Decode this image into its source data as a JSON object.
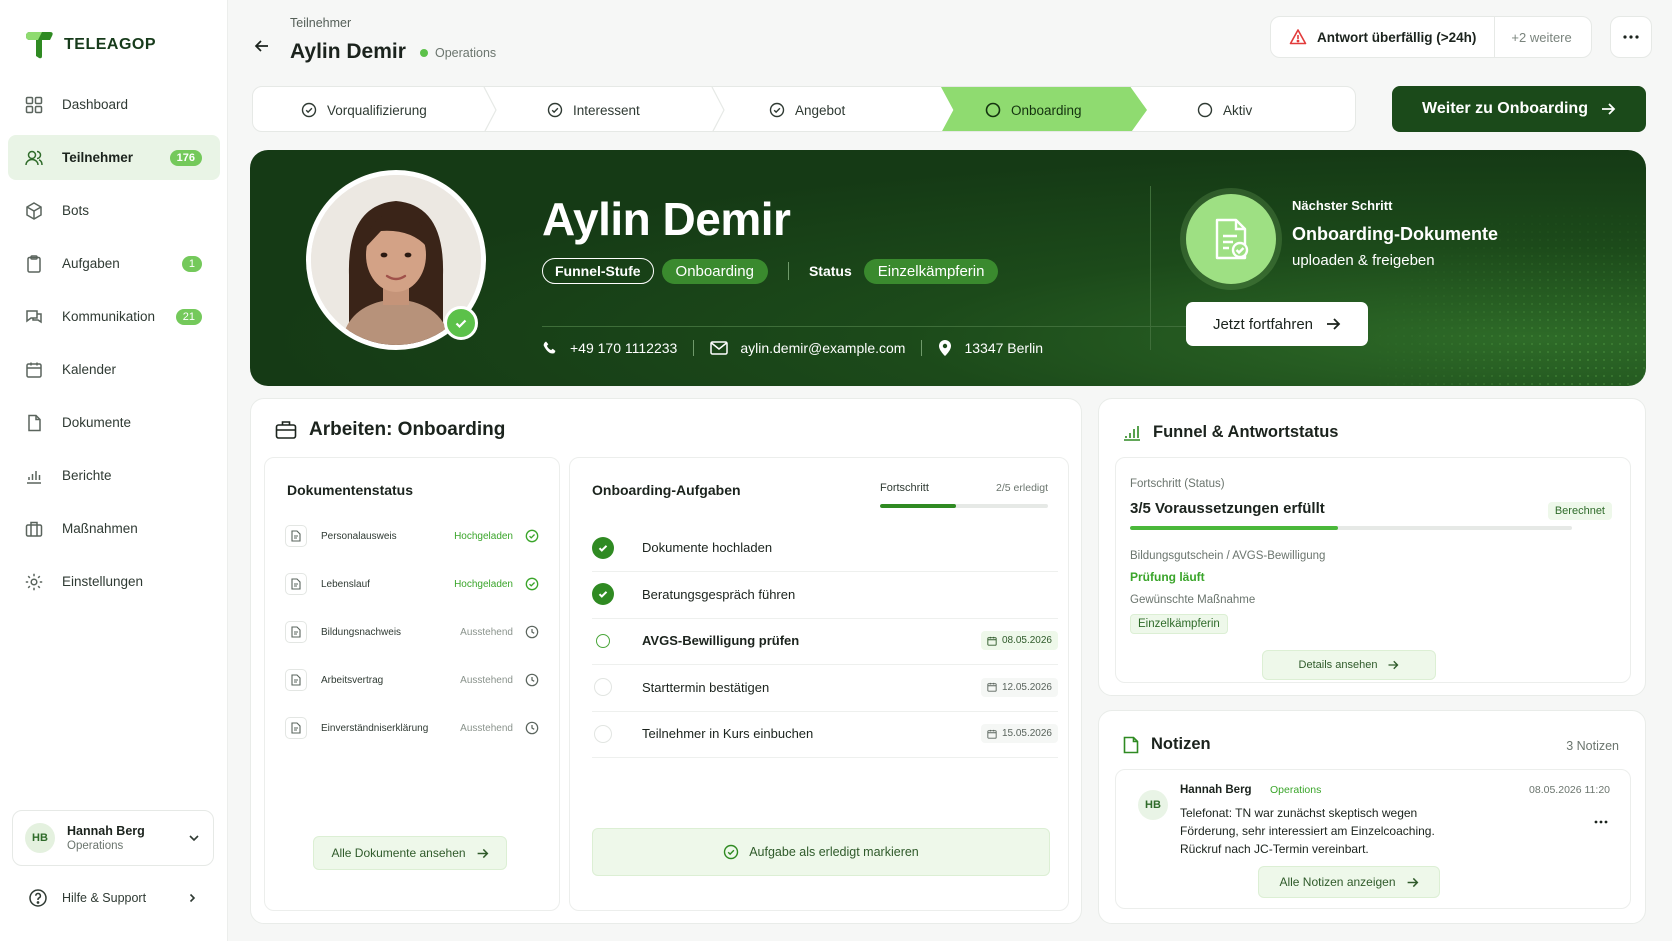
{
  "brand": {
    "name": "TELEAGOP"
  },
  "sidebar": {
    "items": [
      {
        "label": "Dashboard",
        "icon": "grid-icon"
      },
      {
        "label": "Teilnehmer",
        "icon": "users-icon",
        "badge": "176"
      },
      {
        "label": "Bots",
        "icon": "bot-icon"
      },
      {
        "label": "Aufgaben",
        "icon": "clipboard-icon",
        "badge": "1"
      },
      {
        "label": "Kommunikation",
        "icon": "chat-icon",
        "badge": "21"
      },
      {
        "label": "Kalender",
        "icon": "calendar-icon"
      },
      {
        "label": "Dokumente",
        "icon": "file-icon"
      },
      {
        "label": "Berichte",
        "icon": "bar-chart-icon"
      },
      {
        "label": "Maßnahmen",
        "icon": "briefcase-icon"
      },
      {
        "label": "Einstellungen",
        "icon": "gear-icon"
      }
    ],
    "user": {
      "initials": "HB",
      "name": "Hannah Berg",
      "team": "Operations"
    },
    "help": "Hilfe & Support"
  },
  "header": {
    "breadcrumb": "Teilnehmer",
    "title": "Aylin Demir",
    "team": "Operations",
    "alert": "Antwort überfällig (>24h)",
    "alert_more": "+2 weitere"
  },
  "stepper": {
    "steps": [
      "Vorqualifizierung",
      "Interessent",
      "Angebot",
      "Onboarding",
      "Aktiv"
    ],
    "active": "Onboarding",
    "cta": "Weiter zu Onboarding"
  },
  "hero": {
    "name": "Aylin Demir",
    "funnel_label": "Funnel-Stufe",
    "funnel_value": "Onboarding",
    "status_label": "Status",
    "status_value": "Einzelkämpferin",
    "phone": "+49 170 1112233",
    "email": "aylin.demir@example.com",
    "location": "13347 Berlin",
    "next_label": "Nächster Schritt",
    "next_title": "Onboarding-Dokumente",
    "next_sub": "uploaden & freigeben",
    "next_button": "Jetzt fortfahren"
  },
  "work": {
    "title": "Arbeiten: Onboarding",
    "documents": {
      "title": "Dokumentenstatus",
      "rows": [
        {
          "name": "Personalausweis",
          "status": "Hochgeladen",
          "state": "done"
        },
        {
          "name": "Lebenslauf",
          "status": "Hochgeladen",
          "state": "done"
        },
        {
          "name": "Bildungsnachweis",
          "status": "Ausstehend",
          "state": "wait"
        },
        {
          "name": "Arbeitsvertrag",
          "status": "Ausstehend",
          "state": "wait"
        },
        {
          "name": "Einverständniserklärung",
          "status": "Ausstehend",
          "state": "wait"
        }
      ],
      "button": "Alle Dokumente ansehen"
    },
    "tasks": {
      "title": "Onboarding-Aufgaben",
      "progress_label": "Fortschritt",
      "progress_text": "2/5 erledigt",
      "progress_value": 0.45,
      "rows": [
        {
          "name": "Dokumente hochladen",
          "state": "done",
          "date": ""
        },
        {
          "name": "Beratungsgespräch führen",
          "state": "done",
          "date": ""
        },
        {
          "name": "AVGS-Bewilligung prüfen",
          "state": "open",
          "date": "08.05.2026"
        },
        {
          "name": "Starttermin bestätigen",
          "state": "empty",
          "date": "12.05.2026"
        },
        {
          "name": "Teilnehmer in Kurs einbuchen",
          "state": "empty",
          "date": "15.05.2026"
        }
      ],
      "button": "Aufgabe als erledigt markieren"
    }
  },
  "funnel": {
    "title": "Funnel & Antwortstatus",
    "progress_label": "Fortschritt (Status)",
    "progress_text": "3/5 Voraussetzungen erfüllt",
    "progress_value": 0.47,
    "badge": "Berechnet",
    "voucher_label": "Bildungsgutschein / AVGS-Bewilligung",
    "voucher_value": "Prüfung läuft",
    "measure_label": "Gewünschte Maßnahme",
    "measure_value": "Einzelkämpferin",
    "button": "Details ansehen"
  },
  "notes": {
    "title": "Notizen",
    "count": "3 Notizen",
    "author_initials": "HB",
    "author": "Hannah Berg",
    "team": "Operations",
    "timestamp": "08.05.2026 11:20",
    "line1": "Telefonat: TN war zunächst skeptisch wegen",
    "line2": "Förderung, sehr interessiert am Einzelcoaching.",
    "line3": "Rückruf nach JC-Termin vereinbart.",
    "button": "Alle Notizen anzeigen"
  },
  "colors": {
    "brand_dark": "#1b4a1a",
    "accent": "#8fdb70",
    "success": "#2f8a22",
    "alert": "#e23b3b"
  }
}
